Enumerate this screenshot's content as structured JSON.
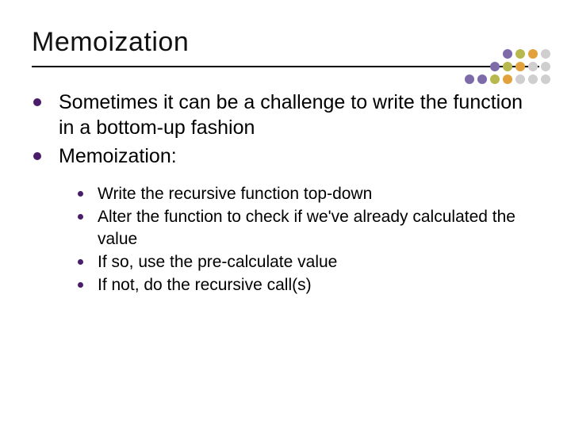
{
  "title": "Memoization",
  "bullets_l1": [
    "Sometimes it can be a challenge to write the function in a bottom-up fashion",
    "Memoization:"
  ],
  "bullets_l2": [
    "Write the recursive function top-down",
    "Alter the function to check if we've already calculated the value",
    "If so, use the pre-calculate value",
    "If not, do the recursive call(s)"
  ],
  "dot_colors": {
    "purple": "#7d6aa9",
    "olive": "#b7b94e",
    "orange": "#e2a13a",
    "gray": "#cfcfcf"
  },
  "dot_grid": [
    [
      "",
      "",
      "",
      "purple",
      "olive",
      "orange",
      "gray"
    ],
    [
      "",
      "",
      "purple",
      "olive",
      "orange",
      "gray",
      "gray"
    ],
    [
      "purple",
      "purple",
      "olive",
      "orange",
      "gray",
      "gray",
      "gray"
    ]
  ]
}
